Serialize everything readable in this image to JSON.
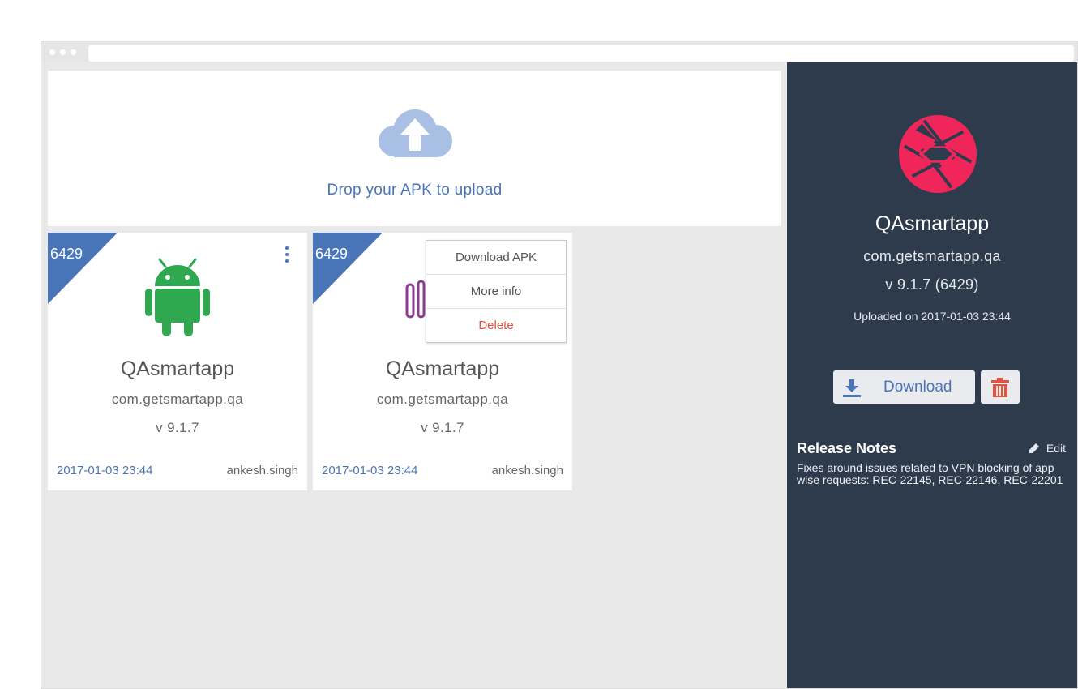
{
  "upload": {
    "text": "Drop your APK to upload"
  },
  "cards": [
    {
      "build": "6429",
      "name": "QAsmartapp",
      "package": "com.getsmartapp.qa",
      "version": "v 9.1.7",
      "date": "2017-01-03 23:44",
      "user": "ankesh.singh",
      "icon": "android-icon"
    },
    {
      "build": "6429",
      "name": "QAsmartapp",
      "package": "com.getsmartapp.qa",
      "version": "v 9.1.7",
      "date": "2017-01-03 23:44",
      "user": "ankesh.singh",
      "icon": "app-logo-icon"
    }
  ],
  "context_menu": {
    "items": [
      "Download APK",
      "More info",
      "Delete"
    ]
  },
  "sidebar": {
    "app_name": "QAsmartapp",
    "package": "com.getsmartapp.qa",
    "version": "v 9.1.7 (6429)",
    "uploaded": "Uploaded on 2017-01-03 23:44",
    "download_label": "Download",
    "release_notes_title": "Release Notes",
    "edit_label": "Edit",
    "release_notes": "Fixes around issues related to VPN blocking of app wise requests: REC-22145, REC-22146, REC-22201"
  },
  "colors": {
    "accent": "#4a74b8",
    "sidebar_bg": "#2d3b4d",
    "logo": "#f0265a",
    "android": "#2fa84f",
    "delete": "#e0533f"
  }
}
